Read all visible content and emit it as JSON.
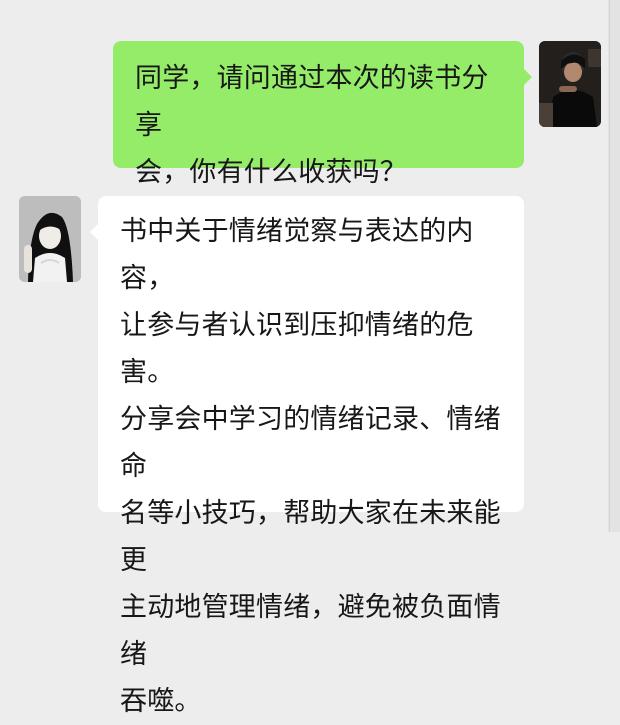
{
  "chat": {
    "messages": [
      {
        "sender": "self",
        "avatar_icon": "self-avatar-icon",
        "text": "同学，请问通过本次的读书分享\n会，你有什么收获吗？"
      },
      {
        "sender": "other",
        "avatar_icon": "other-avatar-icon",
        "text": "书中关于情绪觉察与表达的内容，\n让参与者认识到压抑情绪的危害。\n分享会中学习的情绪记录、情绪命\n名等小技巧，帮助大家在未来能更\n主动地管理情绪，避免被负面情绪\n吞噬。"
      }
    ]
  },
  "colors": {
    "background": "#ededed",
    "sent_bubble": "#95ec69",
    "received_bubble": "#ffffff",
    "text": "#171717"
  }
}
